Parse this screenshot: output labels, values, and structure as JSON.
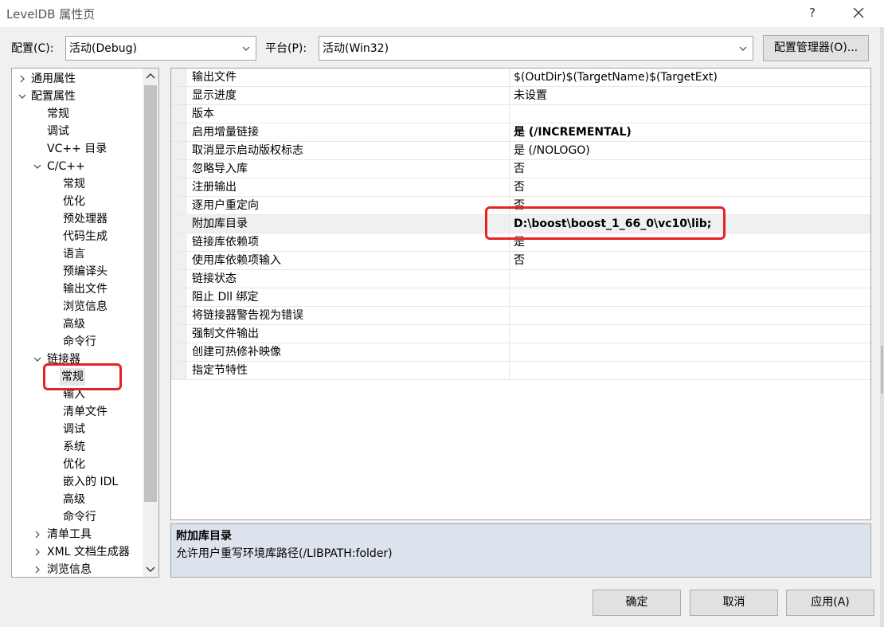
{
  "window": {
    "title": "LevelDB 属性页",
    "help_label": "?",
    "close_icon": "close-icon"
  },
  "toolbar": {
    "config_label": "配置(C):",
    "config_value": "活动(Debug)",
    "platform_label": "平台(P):",
    "platform_value": "活动(Win32)",
    "config_manager_label": "配置管理器(O)..."
  },
  "tree": {
    "items": [
      {
        "label": "通用属性",
        "chevron": "right"
      },
      {
        "label": "配置属性",
        "chevron": "down"
      },
      {
        "label": "常规",
        "chevron": ""
      },
      {
        "label": "调试",
        "chevron": ""
      },
      {
        "label": "VC++ 目录",
        "chevron": ""
      },
      {
        "label": "C/C++",
        "chevron": "down"
      },
      {
        "label": "常规",
        "chevron": ""
      },
      {
        "label": "优化",
        "chevron": ""
      },
      {
        "label": "预处理器",
        "chevron": ""
      },
      {
        "label": "代码生成",
        "chevron": ""
      },
      {
        "label": "语言",
        "chevron": ""
      },
      {
        "label": "预编译头",
        "chevron": ""
      },
      {
        "label": "输出文件",
        "chevron": ""
      },
      {
        "label": "浏览信息",
        "chevron": ""
      },
      {
        "label": "高级",
        "chevron": ""
      },
      {
        "label": "命令行",
        "chevron": ""
      },
      {
        "label": "链接器",
        "chevron": "down"
      },
      {
        "label": "常规",
        "chevron": "",
        "selected": true
      },
      {
        "label": "输入",
        "chevron": ""
      },
      {
        "label": "清单文件",
        "chevron": ""
      },
      {
        "label": "调试",
        "chevron": ""
      },
      {
        "label": "系统",
        "chevron": ""
      },
      {
        "label": "优化",
        "chevron": ""
      },
      {
        "label": "嵌入的 IDL",
        "chevron": ""
      },
      {
        "label": "高级",
        "chevron": ""
      },
      {
        "label": "命令行",
        "chevron": ""
      },
      {
        "label": "清单工具",
        "chevron": "right"
      },
      {
        "label": "XML 文档生成器",
        "chevron": "right"
      },
      {
        "label": "浏览信息",
        "chevron": "right"
      }
    ]
  },
  "grid": {
    "rows": [
      {
        "name": "输出文件",
        "value": "$(OutDir)$(TargetName)$(TargetExt)",
        "bold": false
      },
      {
        "name": "显示进度",
        "value": "未设置",
        "bold": false
      },
      {
        "name": "版本",
        "value": "",
        "bold": false
      },
      {
        "name": "启用增量链接",
        "value": "是 (/INCREMENTAL)",
        "bold": true
      },
      {
        "name": "取消显示启动版权标志",
        "value": "是 (/NOLOGO)",
        "bold": false
      },
      {
        "name": "忽略导入库",
        "value": "否",
        "bold": false
      },
      {
        "name": "注册输出",
        "value": "否",
        "bold": false
      },
      {
        "name": "逐用户重定向",
        "value": "否",
        "bold": false
      },
      {
        "name": "附加库目录",
        "value": "D:\\boost\\boost_1_66_0\\vc10\\lib;",
        "bold": true,
        "selected": true
      },
      {
        "name": "链接库依赖项",
        "value": "是",
        "bold": false
      },
      {
        "name": "使用库依赖项输入",
        "value": "否",
        "bold": false
      },
      {
        "name": "链接状态",
        "value": "",
        "bold": false
      },
      {
        "name": "阻止 Dll 绑定",
        "value": "",
        "bold": false
      },
      {
        "name": "将链接器警告视为错误",
        "value": "",
        "bold": false
      },
      {
        "name": "强制文件输出",
        "value": "",
        "bold": false
      },
      {
        "name": "创建可热修补映像",
        "value": "",
        "bold": false
      },
      {
        "name": "指定节特性",
        "value": "",
        "bold": false
      }
    ]
  },
  "description": {
    "title": "附加库目录",
    "text": "允许用户重写环境库路径(/LIBPATH:folder)"
  },
  "buttons": {
    "ok": "确定",
    "cancel": "取消",
    "apply": "应用(A)"
  },
  "colors": {
    "highlight": "#e62222",
    "description_bg": "#dde3ec"
  }
}
